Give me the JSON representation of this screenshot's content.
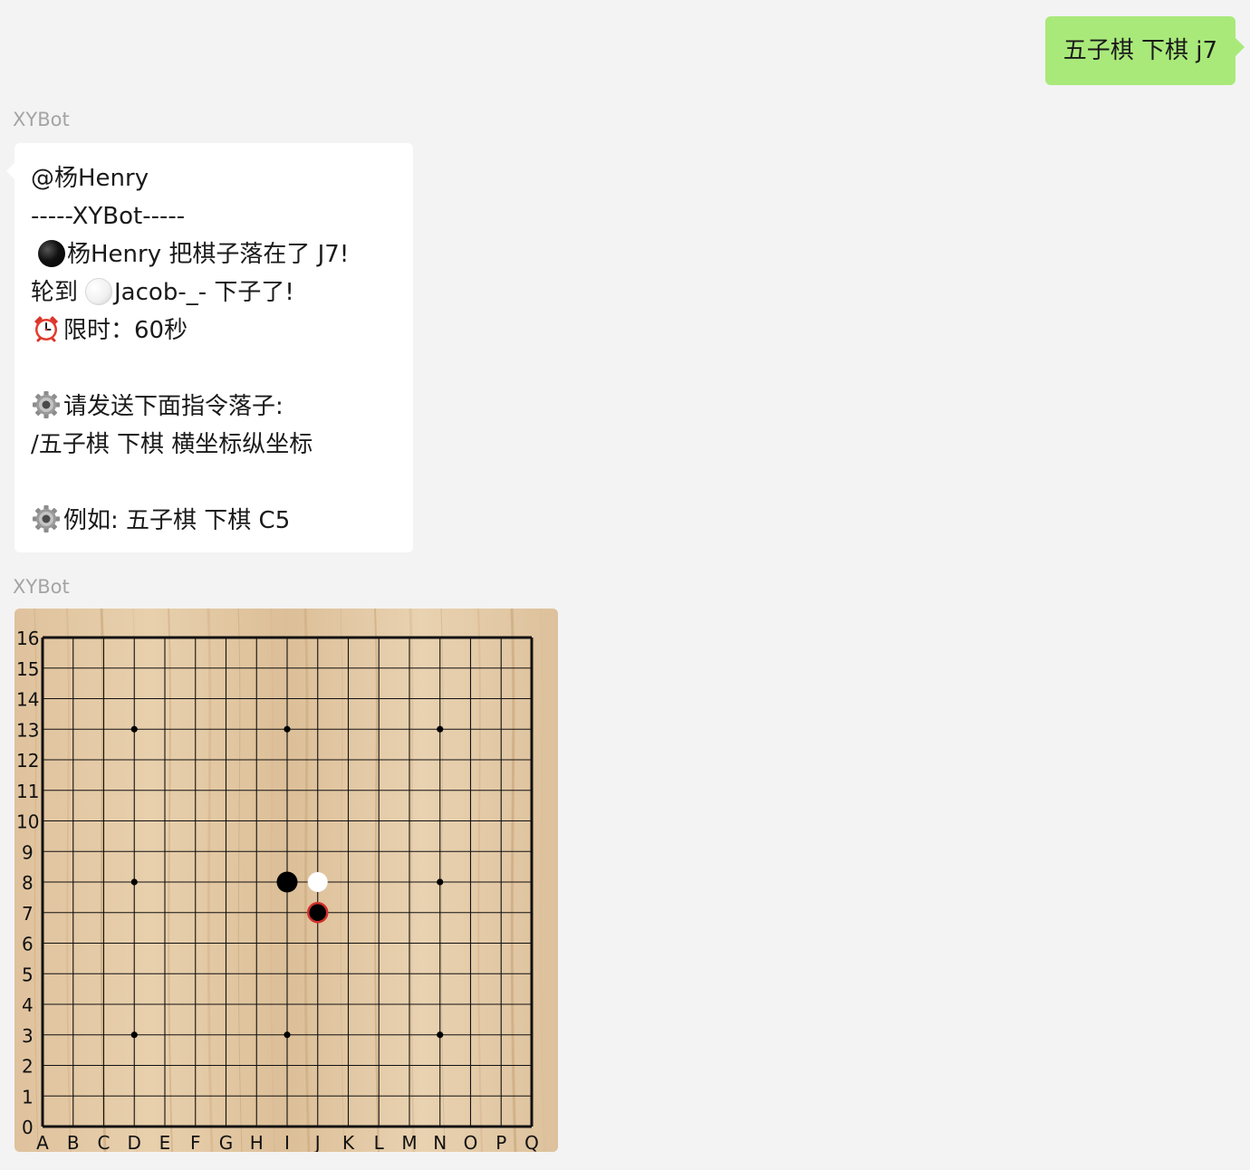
{
  "outgoing": {
    "text": "五子棋 下棋 j7",
    "bubble_color": "#a9e97a"
  },
  "messages": [
    {
      "sender": "XYBot",
      "lines": {
        "mention": "@杨Henry",
        "divider": "-----XYBot-----",
        "move_icon": "black-stone-icon",
        "move_text": "杨Henry 把棋子落在了 J7!",
        "turn_prefix": "轮到",
        "turn_icon": "white-stone-icon",
        "turn_text": "Jacob-_- 下子了!",
        "timer_icon": "alarm-clock-icon",
        "timer_text": "限时：60秒",
        "instruction_icon": "gear-icon",
        "instruction_text": "请发送下面指令落子:",
        "command": "/五子棋 下棋 横坐标纵坐标",
        "example_icon": "gear-icon",
        "example_text": "例如: 五子棋 下棋 C5"
      }
    },
    {
      "sender": "XYBot",
      "board": {
        "columns": [
          "A",
          "B",
          "C",
          "D",
          "E",
          "F",
          "G",
          "H",
          "I",
          "J",
          "K",
          "L",
          "M",
          "N",
          "O",
          "P",
          "Q"
        ],
        "rows": [
          "0",
          "1",
          "2",
          "3",
          "4",
          "5",
          "6",
          "7",
          "8",
          "9",
          "10",
          "11",
          "12",
          "13",
          "14",
          "15",
          "16"
        ],
        "star_points": [
          "D3",
          "I3",
          "N3",
          "D8",
          "N8",
          "D13",
          "I13",
          "N13"
        ],
        "stones": [
          {
            "position": "I8",
            "color": "black",
            "last_move": false
          },
          {
            "position": "J8",
            "color": "white",
            "last_move": false
          },
          {
            "position": "J7",
            "color": "black",
            "last_move": true
          }
        ],
        "wood_color": "#e2c8a5",
        "last_move_ring_color": "#d0302a"
      }
    }
  ]
}
